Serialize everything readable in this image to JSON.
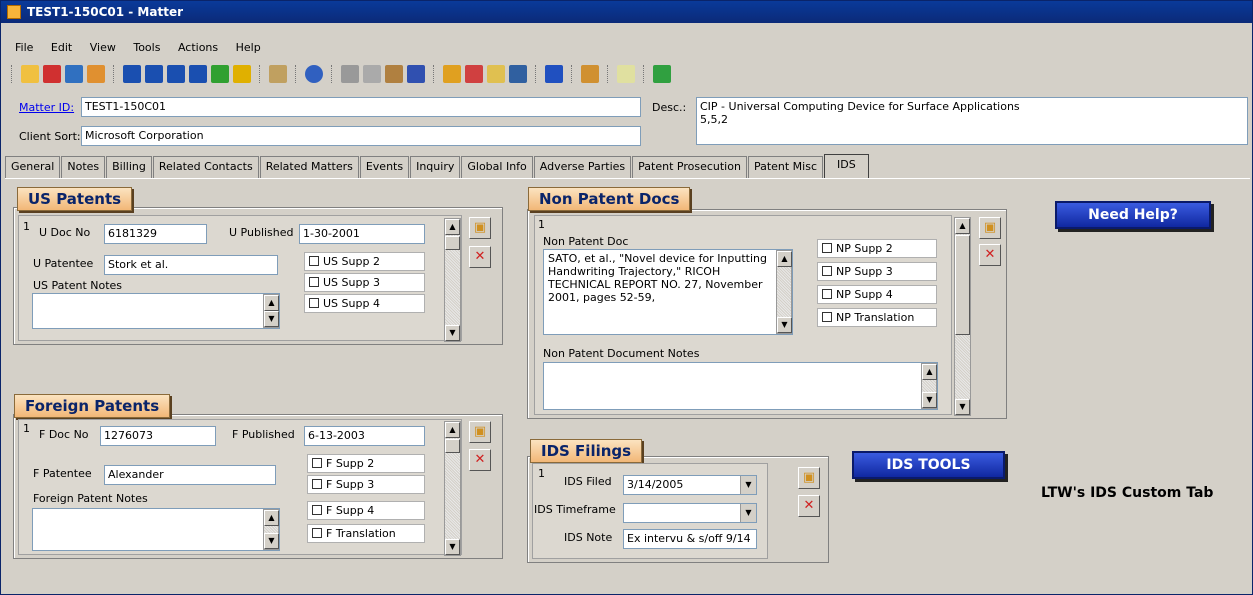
{
  "window": {
    "title": "TEST1-150C01 - Matter"
  },
  "menu": [
    "File",
    "Edit",
    "View",
    "Tools",
    "Actions",
    "Help"
  ],
  "header": {
    "matter_id_label": "Matter ID:",
    "matter_id_value": "TEST1-150C01",
    "client_sort_label": "Client Sort:",
    "client_sort_value": "Microsoft Corporation",
    "desc_label": "Desc.:",
    "desc_value_1": "CIP - Universal Computing Device for Surface Applications",
    "desc_value_2": "5,5,2"
  },
  "tabs": [
    "General",
    "Notes",
    "Billing",
    "Related Contacts",
    "Related Matters",
    "Events",
    "Inquiry",
    "Global Info",
    "Adverse Parties",
    "Patent Prosecution",
    "Patent Misc",
    "IDS"
  ],
  "us_patents": {
    "title": "US Patents",
    "record_num": "1",
    "doc_no_label": "U Doc No",
    "doc_no_value": "6181329",
    "published_label": "U Published",
    "published_value": "1-30-2001",
    "patentee_label": "U Patentee",
    "patentee_value": "Stork et al.",
    "notes_label": "US Patent Notes",
    "checks": [
      "US Supp 2",
      "US Supp 3",
      "US Supp 4"
    ]
  },
  "foreign_patents": {
    "title": "Foreign Patents",
    "record_num": "1",
    "doc_no_label": "F Doc No",
    "doc_no_value": "1276073",
    "published_label": "F Published",
    "published_value": "6-13-2003",
    "patentee_label": "F Patentee",
    "patentee_value": "Alexander",
    "notes_label": "Foreign Patent Notes",
    "checks": [
      "F Supp 2",
      "F Supp 3",
      "F Supp 4",
      "F Translation"
    ]
  },
  "non_patent_docs": {
    "title": "Non Patent Docs",
    "record_num": "1",
    "doc_label": "Non Patent Doc",
    "doc_text": "SATO, et al., \"Novel device for Inputting Handwriting Trajectory,\" RICOH TECHNICAL REPORT NO. 27, November 2001, pages 52-59,",
    "notes_label": "Non Patent Document Notes",
    "checks": [
      "NP Supp 2",
      "NP Supp 3",
      "NP Supp 4",
      "NP Translation"
    ]
  },
  "ids_filings": {
    "title": "IDS Filings",
    "record_num": "1",
    "filed_label": "IDS Filed",
    "filed_value": "3/14/2005",
    "timeframe_label": "IDS Timeframe",
    "timeframe_value": "",
    "note_label": "IDS Note",
    "note_value": "Ex intervu & s/off  9/14"
  },
  "buttons": {
    "need_help": "Need Help?",
    "ids_tools": "IDS TOOLS"
  },
  "custom_tab_label": "LTW's IDS Custom Tab"
}
